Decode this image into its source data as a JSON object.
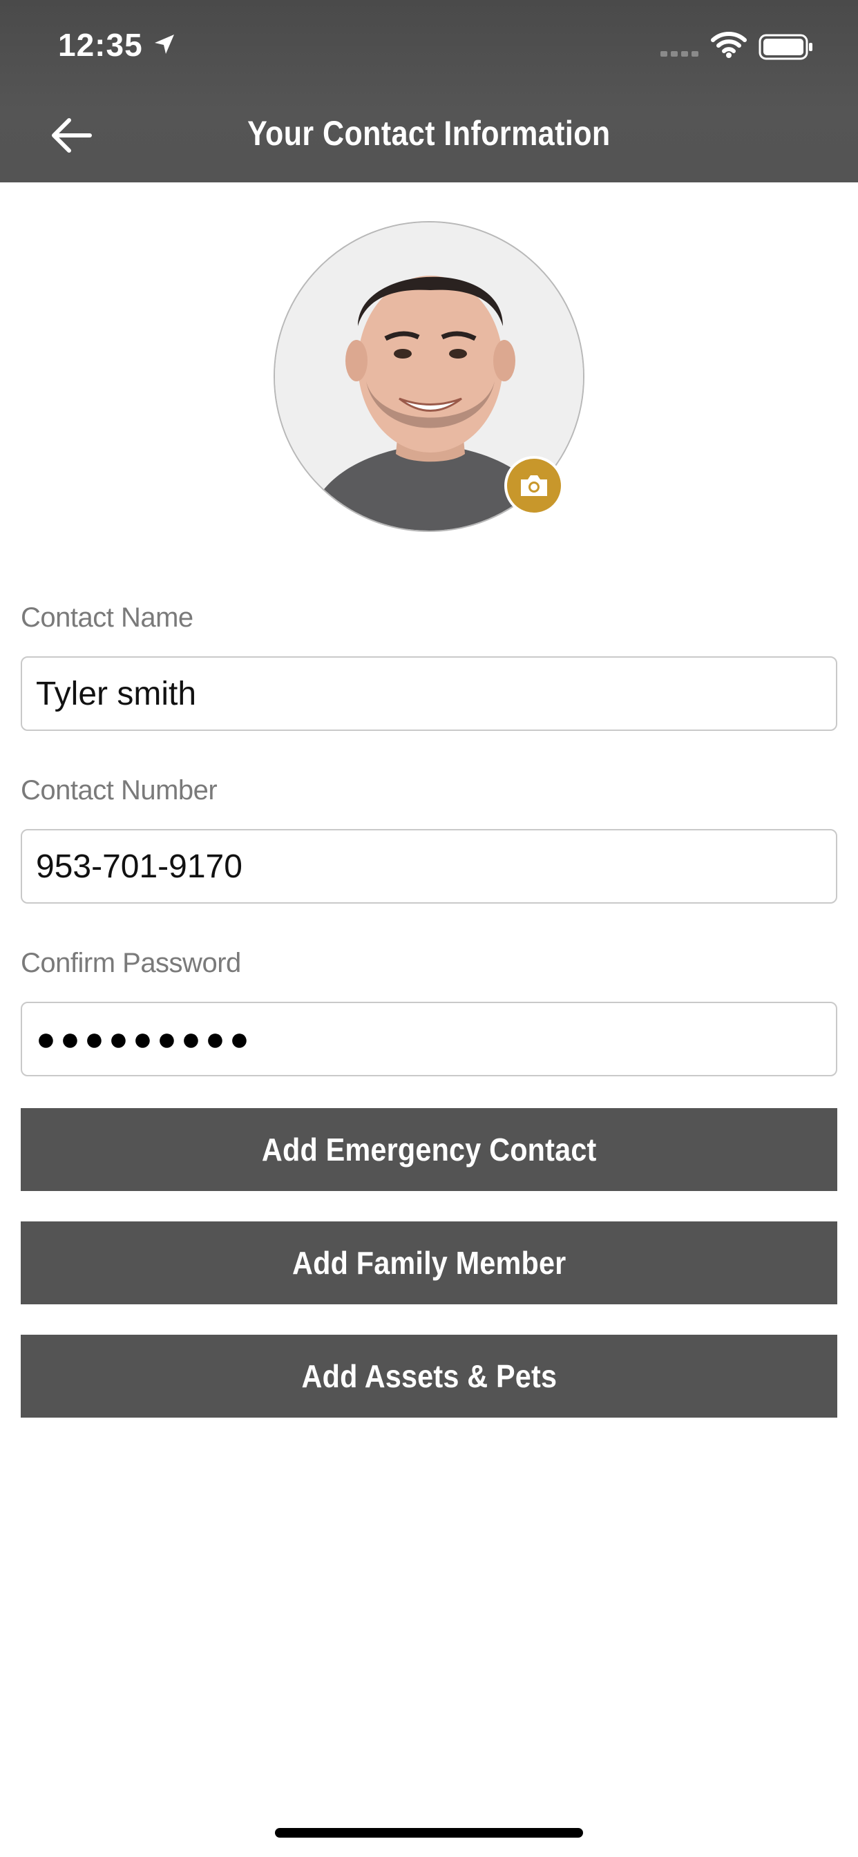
{
  "status_bar": {
    "time": "12:35"
  },
  "header": {
    "title": "Your Contact Information"
  },
  "icons": {
    "back": "arrow-left-icon",
    "camera": "camera-icon",
    "location": "location-arrow-icon",
    "wifi": "wifi-icon",
    "battery": "battery-icon",
    "signal": "signal-icon"
  },
  "form": {
    "contact_name": {
      "label": "Contact Name",
      "value": "Tyler smith"
    },
    "contact_number": {
      "label": "Contact Number",
      "value": "953-701-9170"
    },
    "confirm_password": {
      "label": "Confirm Password",
      "value": "●●●●●●●●●"
    }
  },
  "buttons": {
    "emergency": "Add Emergency Contact",
    "family": "Add Family Member",
    "assets": "Add Assets & Pets"
  },
  "colors": {
    "header_bg": "#545454",
    "button_bg": "#545454",
    "camera_accent": "#c8972b"
  }
}
